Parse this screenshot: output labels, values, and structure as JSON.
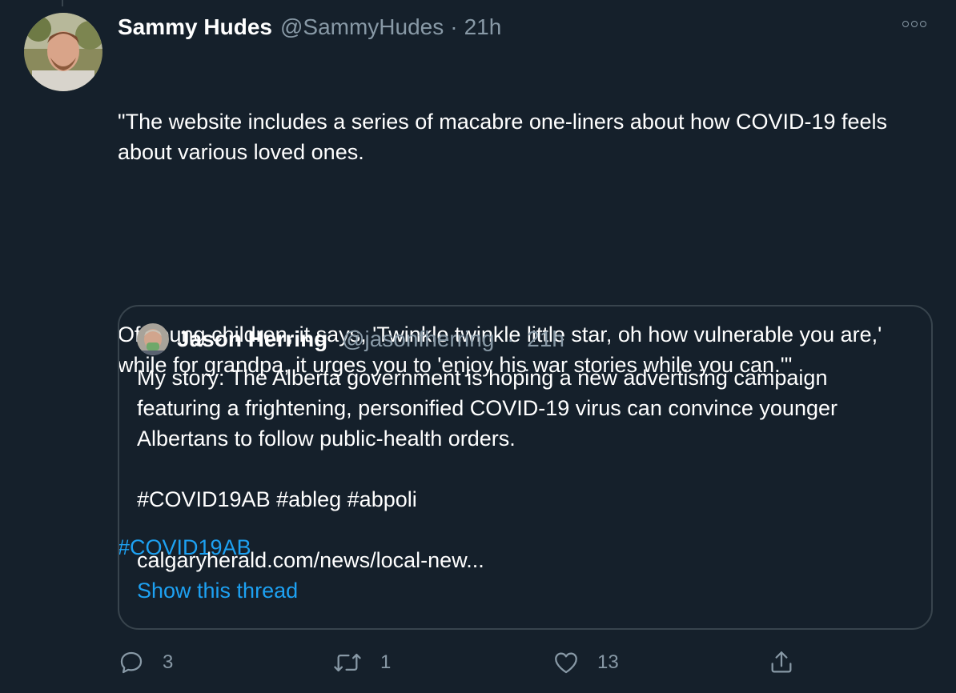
{
  "tweet": {
    "author_name": "Sammy Hudes",
    "author_handle": "@SammyHudes",
    "separator": "·",
    "time": "21h",
    "paragraph1": "\"The website includes a series of macabre one-liners about how COVID-19 feels about various loved ones.",
    "paragraph2": "Of young children, it says, 'Twinkle twinkle little star, oh how vulnerable you are,' while for grandpa, it urges you to 'enjoy his war stories while you can.'\"",
    "hashtag": "#COVID19AB"
  },
  "quote": {
    "author_name": "Jason Herring",
    "author_handle": "@jasonfherring",
    "separator": "·",
    "time": "21h",
    "paragraph1": "My story: The Alberta government is hoping a new advertising campaign featuring a frightening, personified COVID-19 virus can convince younger Albertans to follow public-health orders.",
    "hashtags": "#COVID19AB #ableg #abpoli",
    "link": "calgaryherald.com/news/local-new...",
    "show_thread": "Show this thread"
  },
  "actions": {
    "reply_count": "3",
    "retweet_count": "1",
    "like_count": "13"
  },
  "icons": {
    "more": "more-icon",
    "reply": "reply-icon",
    "retweet": "retweet-icon",
    "like": "heart-icon",
    "share": "share-icon"
  },
  "colors": {
    "background": "#15202b",
    "accent": "#1da1f2",
    "secondary_text": "#8899a6",
    "border": "#38444d"
  }
}
